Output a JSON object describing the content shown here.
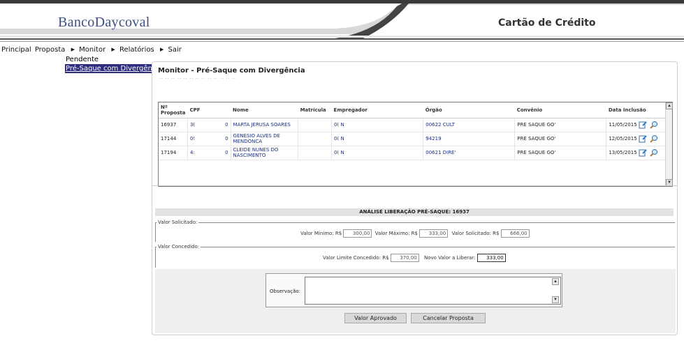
{
  "header": {
    "logo_text": "BancoDaycoval",
    "app_title": "Cartão de Crédito"
  },
  "menu": {
    "items": [
      "Principal",
      "Proposta",
      "Monitor",
      "Relatórios",
      "Sair"
    ],
    "submenu": [
      "Pendente",
      "Pré-Saque com Divergência"
    ]
  },
  "page": {
    "title": "Monitor - Pré-Saque com Divergência",
    "dots": "·· ·· ·· ·· ·· ·· ·· ·· ·· ·· ·· ·· ··"
  },
  "grid": {
    "columns": [
      "Nº Proposta",
      "CPF",
      "Nome",
      "Matrícula",
      "Empregador",
      "Órgão",
      "Convênio",
      "Data Inclusão"
    ],
    "rows": [
      {
        "proposta": "16937",
        "cpf": "3(",
        "cpf2": "0",
        "nome": "MARTA JERUSA SOARES",
        "matricula": "",
        "empregador": "0( N",
        "orgao": "00622 CULT",
        "convenio": "PRE SAQUE GO'",
        "data": "11/05/2015"
      },
      {
        "proposta": "17144",
        "cpf": "0!",
        "cpf2": "0",
        "nome": "GENESIO ALVES DE MENDONCA",
        "matricula": "",
        "empregador": "0( N",
        "orgao": "94219",
        "convenio": "PRE SAQUE GO'",
        "data": "12/05/2015"
      },
      {
        "proposta": "17194",
        "cpf": "4:",
        "cpf2": "0",
        "nome": "CLEIDE NUNES DO NASCIMENTO",
        "matricula": "",
        "empregador": "0( N",
        "orgao": "00621 DIRE'",
        "convenio": "PRE SAQUE GO'",
        "data": "13/05/2015"
      }
    ]
  },
  "analise": {
    "title": "ANÁLISE LIBERAÇÃO PRÉ-SAQUE: 16937",
    "solicitado_legend": "Valor Solicitado:",
    "valor_minimo_label": "Valor Mínimo: R$",
    "valor_minimo": "300,00",
    "valor_maximo_label": "Valor Máximo: R$",
    "valor_maximo": "333,00",
    "valor_solicitado_label": "Valor Solicitado: R$",
    "valor_solicitado": "666,00",
    "concedido_legend": "Valor Concedido:",
    "limite_label": "Valor Limite Concedido: R$",
    "limite": "370,00",
    "novo_valor_label": "Novo Valor a Liberar:",
    "novo_valor": "333,00",
    "observacao_label": "Observação:",
    "observacao": ""
  },
  "buttons": {
    "aprovado": "Valor Aprovado",
    "cancelar": "Cancelar Proposta"
  }
}
